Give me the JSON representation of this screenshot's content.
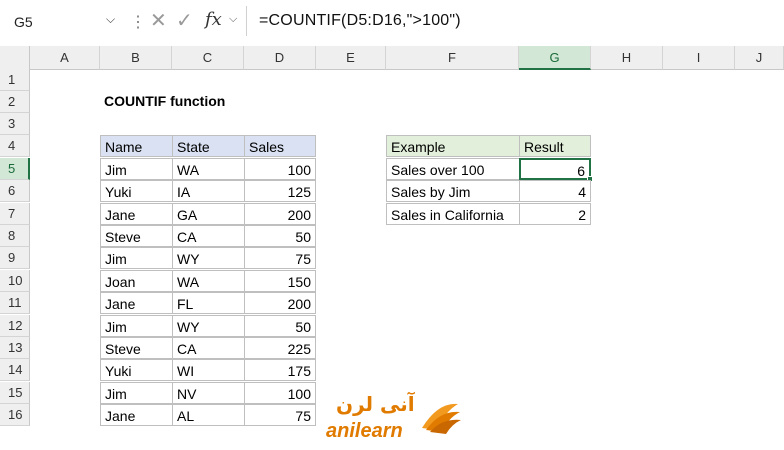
{
  "formula_bar": {
    "name_box": "G5",
    "cancel_icon": "✕",
    "enter_icon": "✓",
    "fx_label": "fx",
    "formula": "=COUNTIF(D5:D16,\">100\")"
  },
  "columns": [
    "A",
    "B",
    "C",
    "D",
    "E",
    "F",
    "G",
    "H",
    "I",
    "J"
  ],
  "rows": [
    "1",
    "2",
    "3",
    "4",
    "5",
    "6",
    "7",
    "8",
    "9",
    "10",
    "11",
    "12",
    "13",
    "14",
    "15",
    "16"
  ],
  "title": "COUNTIF function",
  "data_table": {
    "headers": [
      "Name",
      "State",
      "Sales"
    ],
    "rows": [
      [
        "Jim",
        "WA",
        "100"
      ],
      [
        "Yuki",
        "IA",
        "125"
      ],
      [
        "Jane",
        "GA",
        "200"
      ],
      [
        "Steve",
        "CA",
        "50"
      ],
      [
        "Jim",
        "WY",
        "75"
      ],
      [
        "Joan",
        "WA",
        "150"
      ],
      [
        "Jane",
        "FL",
        "200"
      ],
      [
        "Jim",
        "WY",
        "50"
      ],
      [
        "Steve",
        "CA",
        "225"
      ],
      [
        "Yuki",
        "WI",
        "175"
      ],
      [
        "Jim",
        "NV",
        "100"
      ],
      [
        "Jane",
        "AL",
        "75"
      ]
    ]
  },
  "results_table": {
    "headers": [
      "Example",
      "Result"
    ],
    "rows": [
      [
        "Sales over 100",
        "6"
      ],
      [
        "Sales by Jim",
        "4"
      ],
      [
        "Sales in California",
        "2"
      ]
    ]
  },
  "logo": {
    "text": "anilearn",
    "arabic": "آنی لرن"
  },
  "colors": {
    "header_blue": "#d9e1f2",
    "header_green": "#e2efda",
    "selection_green": "#217346",
    "logo_orange": "#e07b00"
  }
}
